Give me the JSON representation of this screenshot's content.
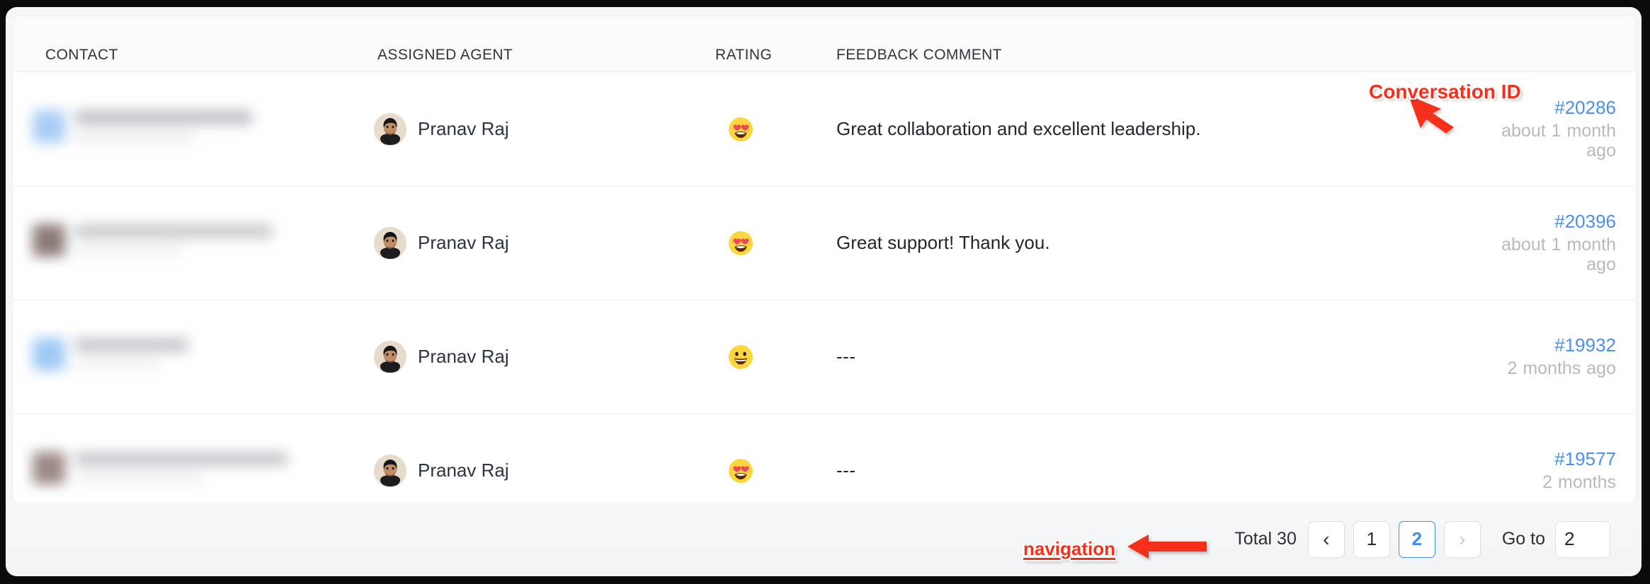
{
  "table": {
    "columns": [
      {
        "key": "contact",
        "label": "CONTACT"
      },
      {
        "key": "agent",
        "label": "ASSIGNED AGENT"
      },
      {
        "key": "rating",
        "label": "RATING"
      },
      {
        "key": "feedback",
        "label": "FEEDBACK COMMENT"
      },
      {
        "key": "conversation",
        "label": ""
      }
    ],
    "rows": [
      {
        "contact": "",
        "agent": "Pranav Raj",
        "rating": "heart-eyes-emoji",
        "rating_glyph": "😍",
        "feedback": "Great collaboration and excellent leadership.",
        "conversation_id": "#20286",
        "time_ago": "about 1 month ago"
      },
      {
        "contact": "",
        "agent": "Pranav Raj",
        "rating": "heart-eyes-emoji",
        "rating_glyph": "😍",
        "feedback": "Great support! Thank you.",
        "conversation_id": "#20396",
        "time_ago": "about 1 month ago"
      },
      {
        "contact": "",
        "agent": "Pranav Raj",
        "rating": "grinning-face-emoji",
        "rating_glyph": "😀",
        "feedback": "---",
        "conversation_id": "#19932",
        "time_ago": "2 months ago"
      },
      {
        "contact": "",
        "agent": "Pranav Raj",
        "rating": "heart-eyes-emoji",
        "rating_glyph": "😍",
        "feedback": "---",
        "conversation_id": "#19577",
        "time_ago": "2 months"
      }
    ]
  },
  "pagination": {
    "total_label": "Total 30",
    "prev_icon": "chevron-left-icon",
    "next_icon": "chevron-right-icon",
    "pages": [
      "1",
      "2"
    ],
    "current_page": "2",
    "goto_label": "Go to",
    "goto_value": "2"
  },
  "annotations": [
    {
      "id": "conversation-id",
      "text": "Conversation ID",
      "color": "#f4301b"
    },
    {
      "id": "navigation",
      "text": "navigation",
      "color": "#f4301b"
    }
  ],
  "colors": {
    "link_blue": "#4a90ee",
    "active_blue": "#3f8cf5",
    "muted_gray": "#b6b9bd",
    "annotation_red": "#f4301b"
  }
}
